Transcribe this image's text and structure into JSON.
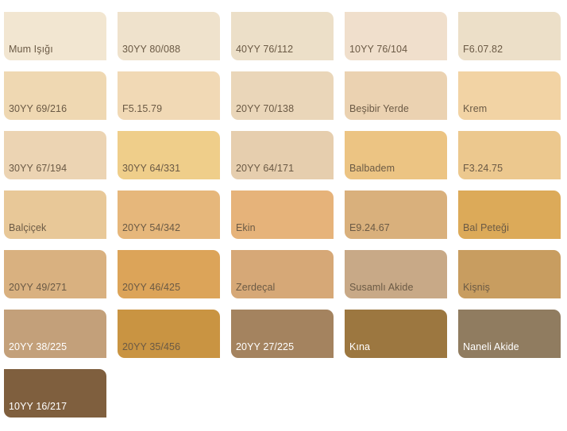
{
  "swatches": [
    {
      "label": "Mum Işığı",
      "color": "#f2e6d1",
      "light_text": false
    },
    {
      "label": "30YY 80/088",
      "color": "#efe2cc",
      "light_text": false
    },
    {
      "label": "40YY 76/112",
      "color": "#ecdfc8",
      "light_text": false
    },
    {
      "label": "10YY 76/104",
      "color": "#f0dfcc",
      "light_text": false
    },
    {
      "label": "F6.07.82",
      "color": "#ecdfc8",
      "light_text": false
    },
    {
      "label": "30YY 69/216",
      "color": "#efd8b2",
      "light_text": false
    },
    {
      "label": "F5.15.79",
      "color": "#f1d9b5",
      "light_text": false
    },
    {
      "label": "20YY 70/138",
      "color": "#ead6b9",
      "light_text": false
    },
    {
      "label": "Beşibir Yerde",
      "color": "#ebd2b1",
      "light_text": false
    },
    {
      "label": "Krem",
      "color": "#f2d3a4",
      "light_text": false
    },
    {
      "label": "30YY 67/194",
      "color": "#ecd4b3",
      "light_text": false
    },
    {
      "label": "30YY 64/331",
      "color": "#efce8a",
      "light_text": false
    },
    {
      "label": "20YY 64/171",
      "color": "#e6ceae",
      "light_text": false
    },
    {
      "label": "Balbadem",
      "color": "#ecc483",
      "light_text": false
    },
    {
      "label": "F3.24.75",
      "color": "#ecc88e",
      "light_text": false
    },
    {
      "label": "Balçiçek",
      "color": "#e8c898",
      "light_text": false
    },
    {
      "label": "20YY 54/342",
      "color": "#e6b77b",
      "light_text": false
    },
    {
      "label": "Ekin",
      "color": "#e6b37a",
      "light_text": false
    },
    {
      "label": "E9.24.67",
      "color": "#d9b07c",
      "light_text": false
    },
    {
      "label": "Bal Peteği",
      "color": "#dcaa59",
      "light_text": false
    },
    {
      "label": "20YY 49/271",
      "color": "#d9b180",
      "light_text": false
    },
    {
      "label": "20YY 46/425",
      "color": "#dca459",
      "light_text": false
    },
    {
      "label": "Zerdeçal",
      "color": "#d6a877",
      "light_text": false
    },
    {
      "label": "Susamlı Akide",
      "color": "#c8a987",
      "light_text": false
    },
    {
      "label": "Kişniş",
      "color": "#c89d60",
      "light_text": false
    },
    {
      "label": "20YY 38/225",
      "color": "#c3a07a",
      "light_text": true
    },
    {
      "label": "20YY 35/456",
      "color": "#c99442",
      "light_text": false
    },
    {
      "label": "20YY 27/225",
      "color": "#a4835f",
      "light_text": true
    },
    {
      "label": "Kına",
      "color": "#9c7740",
      "light_text": true
    },
    {
      "label": "Naneli Akide",
      "color": "#907c60",
      "light_text": true
    },
    {
      "label": "10YY 16/217",
      "color": "#7f5f3e",
      "light_text": true
    }
  ]
}
